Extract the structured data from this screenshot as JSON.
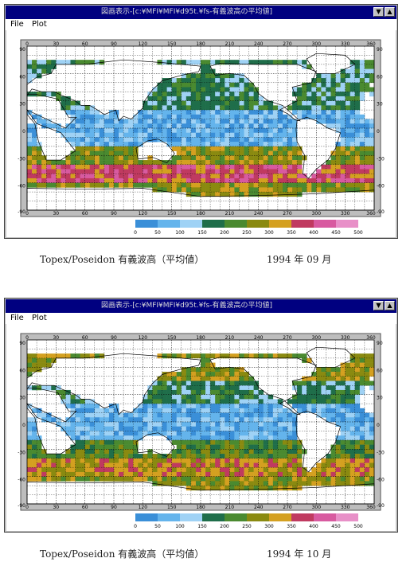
{
  "windows": [
    {
      "title": "図画表示-[c:¥MFI¥MFI¥d95t.¥fs-有義波高の平均値]",
      "menu": {
        "file": "File",
        "plot": "Plot"
      },
      "lat_ticks": [
        "90",
        "60",
        "30",
        "0",
        "-30",
        "-60",
        "-90"
      ],
      "lon_ticks": [
        "0",
        "30",
        "60",
        "90",
        "120",
        "150",
        "180",
        "210",
        "240",
        "270",
        "300",
        "330",
        "360"
      ],
      "legend_labels": [
        "0",
        "50",
        "100",
        "150",
        "200",
        "250",
        "300",
        "350",
        "400",
        "450",
        "500"
      ],
      "caption": {
        "text": "Topex/Poseidon 有義波高（平均値）",
        "date": "1994 年 09 月"
      }
    },
    {
      "title": "図画表示-[c:¥MFI¥MFI¥d95t.¥fs-有義波高の平均値]",
      "menu": {
        "file": "File",
        "plot": "Plot"
      },
      "lat_ticks": [
        "90",
        "60",
        "30",
        "0",
        "-30",
        "-60",
        "-90"
      ],
      "lon_ticks": [
        "0",
        "30",
        "60",
        "90",
        "120",
        "150",
        "180",
        "210",
        "240",
        "270",
        "300",
        "330",
        "360"
      ],
      "legend_labels": [
        "0",
        "50",
        "100",
        "150",
        "200",
        "250",
        "300",
        "350",
        "400",
        "450",
        "500"
      ],
      "caption": {
        "text": "Topex/Poseidon 有義波高（平均値）",
        "date": "1994 年 10 月"
      }
    }
  ],
  "colors": {
    "scale": [
      "#3a8fd8",
      "#64b4ec",
      "#9fd2f5",
      "#1f6e4a",
      "#4a8a30",
      "#8a8a10",
      "#d4a020",
      "#c03a60",
      "#d85aa0",
      "#e890c8"
    ],
    "titlebar": "#000080",
    "window": "#c0c0c0"
  },
  "icons": {
    "minimize": "triangle-down-icon",
    "maximize": "triangle-up-icon"
  }
}
